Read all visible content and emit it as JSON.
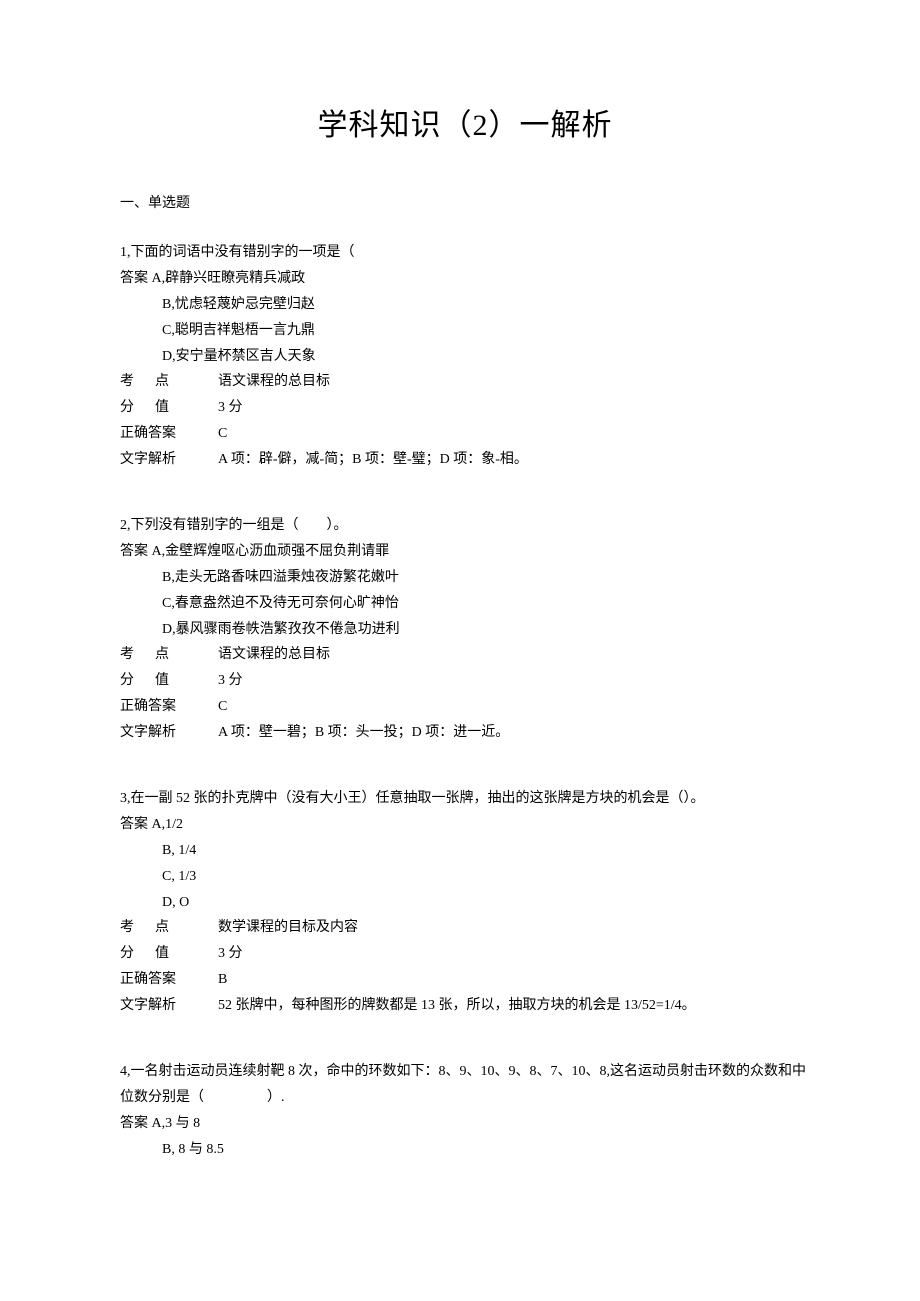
{
  "title": "学科知识（2）一解析",
  "section_header": "一、单选题",
  "questions": [
    {
      "num": "1",
      "stem": "下面的词语中没有错别字的一项是（",
      "options": [
        {
          "label": "A",
          "prefix": "答案 ",
          "text": "辟静兴旺瞭亮精兵减政"
        },
        {
          "label": "B",
          "prefix": "",
          "text": "忧虑轻蔑妒忌完壁归赵"
        },
        {
          "label": "C",
          "prefix": "",
          "text": "聪明吉祥魁梧一言九鼎"
        },
        {
          "label": "D",
          "prefix": "",
          "text": "安宁量杯禁区吉人天象"
        }
      ],
      "meta": {
        "kaodian_label": "考      点",
        "kaodian": "语文课程的总目标",
        "fenzhi_label": "分      值",
        "fenzhi": "3 分",
        "answer_label": "正确答案",
        "answer": "C",
        "analysis_label": "文字解析",
        "analysis": "A 项：辟-僻，减-简；B 项：壁-璧；D 项：象-相。"
      }
    },
    {
      "num": "2",
      "stem": "下列没有错别字的一组是（        ）。",
      "options": [
        {
          "label": "A",
          "prefix": "答案 ",
          "text": "金壁辉煌呕心沥血顽强不屈负荆请罪"
        },
        {
          "label": "B",
          "prefix": "",
          "text": "走头无路香味四溢秉烛夜游繁花嫩叶"
        },
        {
          "label": "C",
          "prefix": "",
          "text": "春意盎然迫不及待无可奈何心旷神怡"
        },
        {
          "label": "D",
          "prefix": "",
          "text": "暴风骤雨卷帙浩繁孜孜不倦急功进利"
        }
      ],
      "meta": {
        "kaodian_label": "考      点",
        "kaodian": "语文课程的总目标",
        "fenzhi_label": "分      值",
        "fenzhi": "3 分",
        "answer_label": "正确答案",
        "answer": "C",
        "analysis_label": "文字解析",
        "analysis": "A 项：壁一碧；B 项：头一投；D 项：进一近。"
      }
    },
    {
      "num": "3",
      "stem": "在一副 52 张的扑克牌中（没有大小王）任意抽取一张牌，抽出的这张牌是方块的机会是（）。",
      "options": [
        {
          "label": "A",
          "prefix": "答案 ",
          "text": "1/2"
        },
        {
          "label": "B",
          "prefix": "",
          "text": " 1/4"
        },
        {
          "label": "C",
          "prefix": "",
          "text": " 1/3"
        },
        {
          "label": "D",
          "prefix": "",
          "text": " O"
        }
      ],
      "meta": {
        "kaodian_label": "考      点",
        "kaodian": "数学课程的目标及内容",
        "fenzhi_label": "分      值",
        "fenzhi": "3 分",
        "answer_label": "正确答案",
        "answer": "B",
        "analysis_label": "文字解析",
        "analysis": "52 张牌中，每种图形的牌数都是 13 张，所以，抽取方块的机会是 13/52=1/4。"
      }
    },
    {
      "num": "4",
      "stem": "一名射击运动员连续射靶 8 次，命中的环数如下：8、9、10、9、8、7、10、8,这名运动员射击环数的众数和中位数分别是（                  ）.",
      "options": [
        {
          "label": "A",
          "prefix": "答案 ",
          "text": "3 与 8"
        },
        {
          "label": "B",
          "prefix": "",
          "text": " 8 与 8.5"
        }
      ],
      "meta": null
    }
  ]
}
